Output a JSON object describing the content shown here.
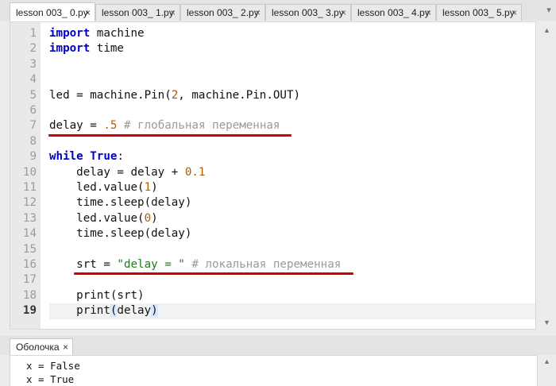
{
  "tabs": [
    {
      "label": "lesson 003_ 0.py",
      "close": "×",
      "active": true
    },
    {
      "label": "lesson 003_ 1.py",
      "close": "×",
      "active": false
    },
    {
      "label": "lesson 003_ 2.py",
      "close": "×",
      "active": false
    },
    {
      "label": "lesson 003_ 3.py",
      "close": "×",
      "active": false
    },
    {
      "label": "lesson 003_ 4.py",
      "close": "×",
      "active": false
    },
    {
      "label": "lesson 003_ 5.py",
      "close": "×",
      "active": false
    }
  ],
  "editor": {
    "current_line": 19,
    "lines": [
      {
        "num": "1",
        "tokens": [
          {
            "t": "kw",
            "v": "import"
          },
          {
            "t": "p",
            "v": " machine"
          }
        ]
      },
      {
        "num": "2",
        "tokens": [
          {
            "t": "kw",
            "v": "import"
          },
          {
            "t": "p",
            "v": " time"
          }
        ]
      },
      {
        "num": "3",
        "tokens": []
      },
      {
        "num": "4",
        "tokens": []
      },
      {
        "num": "5",
        "tokens": [
          {
            "t": "p",
            "v": "led = machine.Pin("
          },
          {
            "t": "n",
            "v": "2"
          },
          {
            "t": "p",
            "v": ", machine.Pin.OUT)"
          }
        ]
      },
      {
        "num": "6",
        "tokens": []
      },
      {
        "num": "7",
        "tokens": [
          {
            "t": "p",
            "v": "delay = "
          },
          {
            "t": "n",
            "v": ".5"
          },
          {
            "t": "p",
            "v": " "
          },
          {
            "t": "c",
            "v": "# глобальная переменная"
          }
        ]
      },
      {
        "num": "8",
        "tokens": []
      },
      {
        "num": "9",
        "tokens": [
          {
            "t": "kw",
            "v": "while"
          },
          {
            "t": "p",
            "v": " "
          },
          {
            "t": "kw",
            "v": "True"
          },
          {
            "t": "p",
            "v": ":"
          }
        ]
      },
      {
        "num": "10",
        "tokens": [
          {
            "t": "p",
            "v": "    delay = delay + "
          },
          {
            "t": "n",
            "v": "0.1"
          }
        ]
      },
      {
        "num": "11",
        "tokens": [
          {
            "t": "p",
            "v": "    led.value("
          },
          {
            "t": "n",
            "v": "1"
          },
          {
            "t": "p",
            "v": ")"
          }
        ]
      },
      {
        "num": "12",
        "tokens": [
          {
            "t": "p",
            "v": "    time.sleep(delay)"
          }
        ]
      },
      {
        "num": "13",
        "tokens": [
          {
            "t": "p",
            "v": "    led.value("
          },
          {
            "t": "n",
            "v": "0"
          },
          {
            "t": "p",
            "v": ")"
          }
        ]
      },
      {
        "num": "14",
        "tokens": [
          {
            "t": "p",
            "v": "    time.sleep(delay)"
          }
        ]
      },
      {
        "num": "15",
        "tokens": []
      },
      {
        "num": "16",
        "tokens": [
          {
            "t": "p",
            "v": "    srt = "
          },
          {
            "t": "s",
            "v": "\"delay = \""
          },
          {
            "t": "p",
            "v": " "
          },
          {
            "t": "c",
            "v": "# локальная переменная"
          }
        ]
      },
      {
        "num": "17",
        "tokens": []
      },
      {
        "num": "18",
        "tokens": [
          {
            "t": "p",
            "v": "    print(srt)"
          }
        ]
      },
      {
        "num": "19",
        "tokens": [
          {
            "t": "p",
            "v": "    print"
          },
          {
            "t": "ph",
            "v": "("
          },
          {
            "t": "p",
            "v": "delay"
          },
          {
            "t": "ph",
            "v": ")"
          }
        ]
      }
    ]
  },
  "annotation_color": "#d40000",
  "shell": {
    "tab_label": "Оболочка",
    "tab_close": "×",
    "output": [
      "x = False",
      "x = True"
    ]
  },
  "icons": {
    "tab_scroll": "chevron-down-icon",
    "scroll_up": "triangle-up-icon",
    "scroll_down": "triangle-down-icon"
  }
}
